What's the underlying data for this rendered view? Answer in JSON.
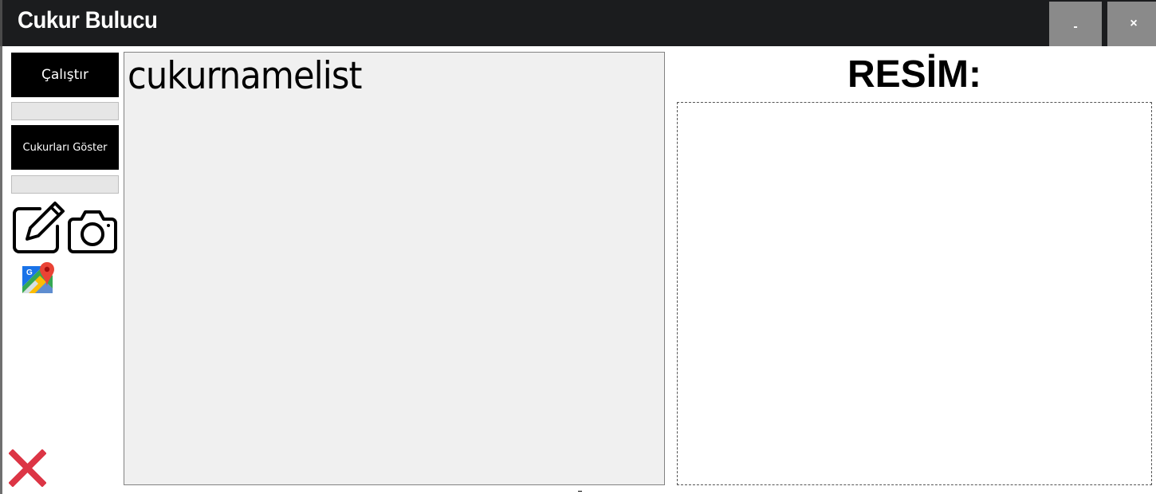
{
  "window": {
    "title": "Cukur Bulucu",
    "minimize_label": "-",
    "close_label": "×"
  },
  "sidebar": {
    "run_button": "Çalıştır",
    "show_button": "Cukurları Göster",
    "icons": [
      "edit-icon",
      "camera-icon",
      "google-maps-icon",
      "red-close-icon"
    ]
  },
  "list": {
    "item": "cukurnamelist"
  },
  "image_panel": {
    "label": "RESİM:"
  },
  "colors": {
    "titlebar": "#1b1c1e",
    "window_button": "#8a8a8a",
    "close_red": "#dc3545"
  }
}
